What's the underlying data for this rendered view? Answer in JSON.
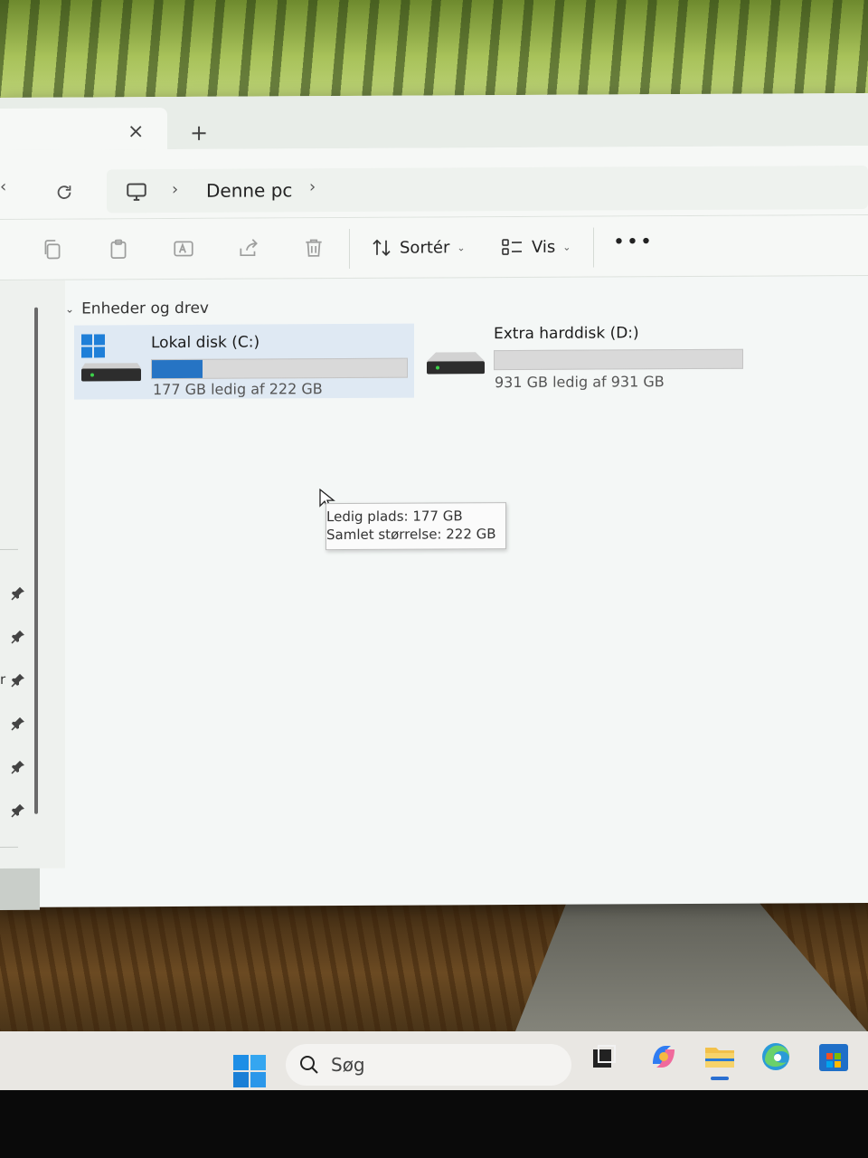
{
  "tabs": {
    "close_symbol": "×",
    "add_symbol": "+"
  },
  "address": {
    "back_symbol": "‹",
    "separator_symbol": "›",
    "current_location": "Denne pc"
  },
  "toolbar": {
    "sort_label": "Sortér",
    "view_label": "Vis",
    "dropdown_symbol": "⌄",
    "more_label": "•••"
  },
  "sidebar": {
    "partial_label": "r"
  },
  "content": {
    "group_chevron": "⌄",
    "group_label": "Enheder og drev",
    "drives": [
      {
        "name": "Lokal disk (C:)",
        "size_text": "177 GB ledig af 222 GB",
        "used_fraction": 0.2
      },
      {
        "name": "Extra harddisk (D:)",
        "size_text": "931 GB ledig af 931 GB",
        "used_fraction": 0.0
      }
    ],
    "tooltip": {
      "line1": "Ledig plads: 177 GB",
      "line2": "Samlet størrelse: 222 GB"
    }
  },
  "taskbar": {
    "search_placeholder": "Søg"
  },
  "colors": {
    "accent": "#2674c4",
    "selection": "#dfe9f3",
    "taskbar": "#e9e7e3"
  },
  "icons": {
    "tab_close": "close-icon",
    "tab_add": "plus-icon",
    "refresh": "refresh-icon",
    "location": "computer-icon",
    "copy": "copy-icon",
    "paste": "paste-icon",
    "rename": "rename-icon",
    "share": "share-icon",
    "delete": "trash-icon",
    "sort": "sort-icon",
    "view": "view-icon",
    "pin": "pin-icon",
    "windows_logo": "windows-logo-icon",
    "drive": "hard-drive-icon",
    "search": "search-icon"
  }
}
